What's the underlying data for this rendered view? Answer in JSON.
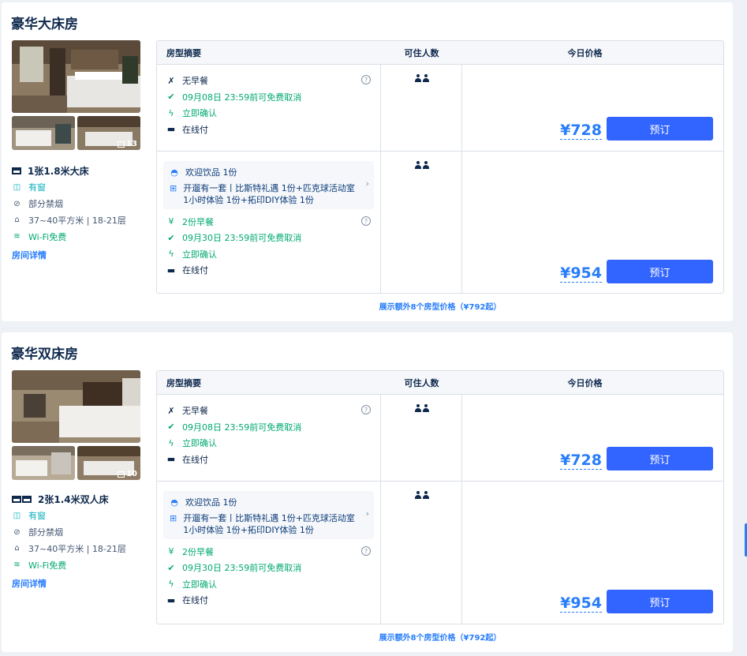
{
  "rooms": [
    {
      "title": "豪华大床房",
      "photo_count": "13",
      "bed": "1张1.8米大床",
      "window": "有窗",
      "smoking": "部分禁烟",
      "size_floor": "37~40平方米 | 18-21层",
      "wifi": "Wi-Fi免费",
      "details_link": "房间详情",
      "more_link": "展示额外8个房型价格（¥792起）"
    },
    {
      "title": "豪华双床房",
      "photo_count": "10",
      "bed": "2张1.4米双人床",
      "window": "有窗",
      "smoking": "部分禁烟",
      "size_floor": "37~40平方米 | 18-21层",
      "wifi": "Wi-Fi免费",
      "details_link": "房间详情",
      "more_link": "展示额外8个房型价格（¥792起）"
    }
  ],
  "table_headers": {
    "summary": "房型摘要",
    "occupancy": "可住人数",
    "price": "今日价格"
  },
  "rate_plans": {
    "basic": {
      "meal": "无早餐",
      "cancel": "09月08日 23:59前可免费取消",
      "confirm": "立即确认",
      "pay": "在线付",
      "price": "¥728",
      "book": "预订"
    },
    "package": {
      "gift_drink": "欢迎饮品 1份",
      "gift_pkg": "开遛有一套丨比斯特礼遇 1份+匹克球活动室1小时体验 1份+拓印DIY体验 1份",
      "meal": "2份早餐",
      "cancel": "09月30日 23:59前可免费取消",
      "confirm": "立即确认",
      "pay": "在线付",
      "price": "¥954",
      "book": "预订"
    }
  },
  "icons": {
    "help": "?",
    "chevron": "›"
  },
  "colors": {
    "accent": "#287dfa",
    "book_button": "#3264ff",
    "green": "#00a971"
  }
}
